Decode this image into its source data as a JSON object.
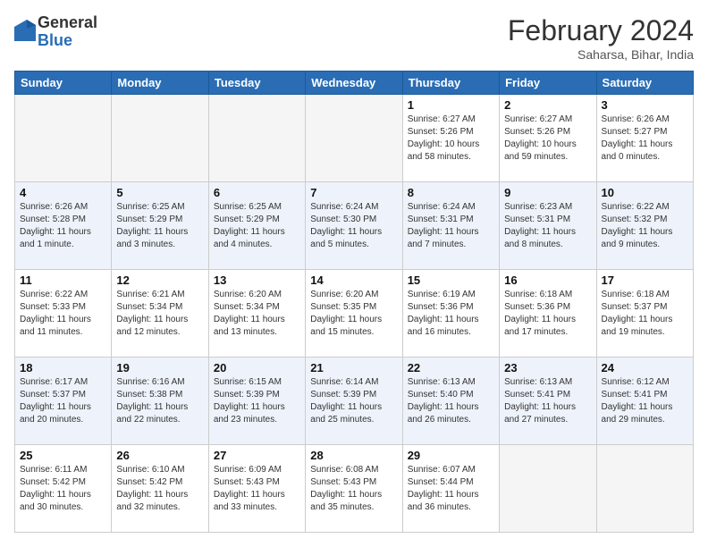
{
  "header": {
    "logo": {
      "general": "General",
      "blue": "Blue"
    },
    "title": "February 2024",
    "subtitle": "Saharsa, Bihar, India"
  },
  "weekdays": [
    "Sunday",
    "Monday",
    "Tuesday",
    "Wednesday",
    "Thursday",
    "Friday",
    "Saturday"
  ],
  "weeks": [
    [
      {
        "day": "",
        "info": ""
      },
      {
        "day": "",
        "info": ""
      },
      {
        "day": "",
        "info": ""
      },
      {
        "day": "",
        "info": ""
      },
      {
        "day": "1",
        "info": "Sunrise: 6:27 AM\nSunset: 5:26 PM\nDaylight: 10 hours and 58 minutes."
      },
      {
        "day": "2",
        "info": "Sunrise: 6:27 AM\nSunset: 5:26 PM\nDaylight: 10 hours and 59 minutes."
      },
      {
        "day": "3",
        "info": "Sunrise: 6:26 AM\nSunset: 5:27 PM\nDaylight: 11 hours and 0 minutes."
      }
    ],
    [
      {
        "day": "4",
        "info": "Sunrise: 6:26 AM\nSunset: 5:28 PM\nDaylight: 11 hours and 1 minute."
      },
      {
        "day": "5",
        "info": "Sunrise: 6:25 AM\nSunset: 5:29 PM\nDaylight: 11 hours and 3 minutes."
      },
      {
        "day": "6",
        "info": "Sunrise: 6:25 AM\nSunset: 5:29 PM\nDaylight: 11 hours and 4 minutes."
      },
      {
        "day": "7",
        "info": "Sunrise: 6:24 AM\nSunset: 5:30 PM\nDaylight: 11 hours and 5 minutes."
      },
      {
        "day": "8",
        "info": "Sunrise: 6:24 AM\nSunset: 5:31 PM\nDaylight: 11 hours and 7 minutes."
      },
      {
        "day": "9",
        "info": "Sunrise: 6:23 AM\nSunset: 5:31 PM\nDaylight: 11 hours and 8 minutes."
      },
      {
        "day": "10",
        "info": "Sunrise: 6:22 AM\nSunset: 5:32 PM\nDaylight: 11 hours and 9 minutes."
      }
    ],
    [
      {
        "day": "11",
        "info": "Sunrise: 6:22 AM\nSunset: 5:33 PM\nDaylight: 11 hours and 11 minutes."
      },
      {
        "day": "12",
        "info": "Sunrise: 6:21 AM\nSunset: 5:34 PM\nDaylight: 11 hours and 12 minutes."
      },
      {
        "day": "13",
        "info": "Sunrise: 6:20 AM\nSunset: 5:34 PM\nDaylight: 11 hours and 13 minutes."
      },
      {
        "day": "14",
        "info": "Sunrise: 6:20 AM\nSunset: 5:35 PM\nDaylight: 11 hours and 15 minutes."
      },
      {
        "day": "15",
        "info": "Sunrise: 6:19 AM\nSunset: 5:36 PM\nDaylight: 11 hours and 16 minutes."
      },
      {
        "day": "16",
        "info": "Sunrise: 6:18 AM\nSunset: 5:36 PM\nDaylight: 11 hours and 17 minutes."
      },
      {
        "day": "17",
        "info": "Sunrise: 6:18 AM\nSunset: 5:37 PM\nDaylight: 11 hours and 19 minutes."
      }
    ],
    [
      {
        "day": "18",
        "info": "Sunrise: 6:17 AM\nSunset: 5:37 PM\nDaylight: 11 hours and 20 minutes."
      },
      {
        "day": "19",
        "info": "Sunrise: 6:16 AM\nSunset: 5:38 PM\nDaylight: 11 hours and 22 minutes."
      },
      {
        "day": "20",
        "info": "Sunrise: 6:15 AM\nSunset: 5:39 PM\nDaylight: 11 hours and 23 minutes."
      },
      {
        "day": "21",
        "info": "Sunrise: 6:14 AM\nSunset: 5:39 PM\nDaylight: 11 hours and 25 minutes."
      },
      {
        "day": "22",
        "info": "Sunrise: 6:13 AM\nSunset: 5:40 PM\nDaylight: 11 hours and 26 minutes."
      },
      {
        "day": "23",
        "info": "Sunrise: 6:13 AM\nSunset: 5:41 PM\nDaylight: 11 hours and 27 minutes."
      },
      {
        "day": "24",
        "info": "Sunrise: 6:12 AM\nSunset: 5:41 PM\nDaylight: 11 hours and 29 minutes."
      }
    ],
    [
      {
        "day": "25",
        "info": "Sunrise: 6:11 AM\nSunset: 5:42 PM\nDaylight: 11 hours and 30 minutes."
      },
      {
        "day": "26",
        "info": "Sunrise: 6:10 AM\nSunset: 5:42 PM\nDaylight: 11 hours and 32 minutes."
      },
      {
        "day": "27",
        "info": "Sunrise: 6:09 AM\nSunset: 5:43 PM\nDaylight: 11 hours and 33 minutes."
      },
      {
        "day": "28",
        "info": "Sunrise: 6:08 AM\nSunset: 5:43 PM\nDaylight: 11 hours and 35 minutes."
      },
      {
        "day": "29",
        "info": "Sunrise: 6:07 AM\nSunset: 5:44 PM\nDaylight: 11 hours and 36 minutes."
      },
      {
        "day": "",
        "info": ""
      },
      {
        "day": "",
        "info": ""
      }
    ]
  ]
}
